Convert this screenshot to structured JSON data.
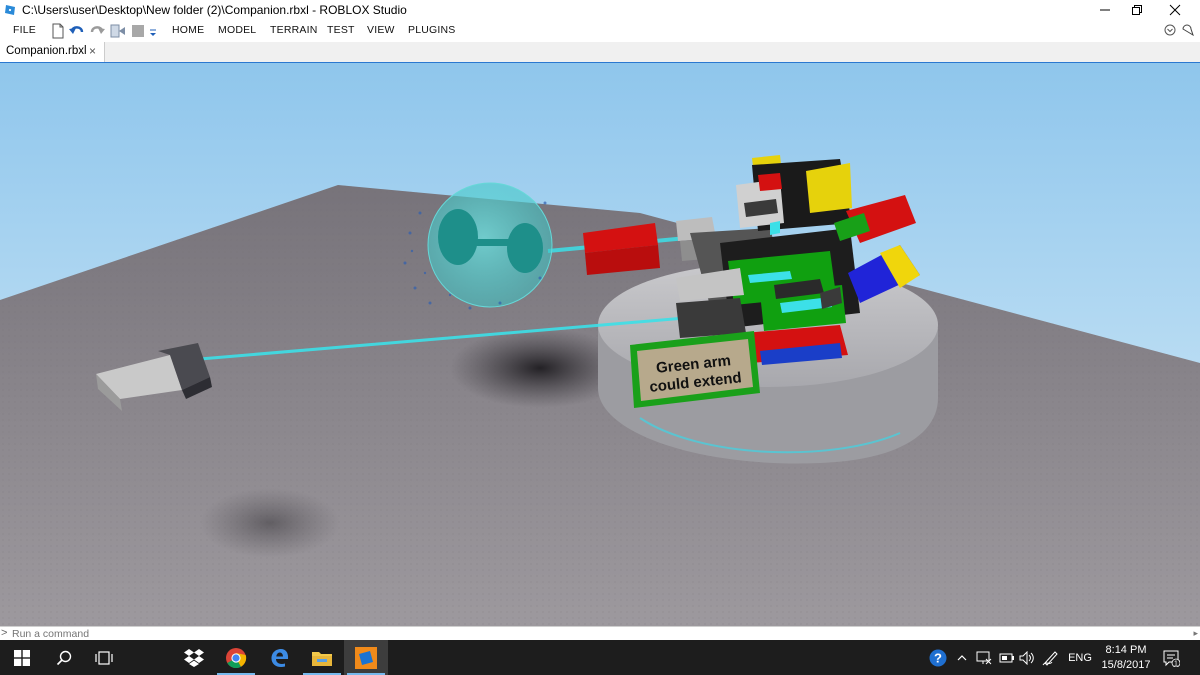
{
  "window": {
    "title": "C:\\Users\\user\\Desktop\\New folder (2)\\Companion.rbxl - ROBLOX Studio",
    "controls": {
      "minimize": "—",
      "restore": "❐",
      "close": "✕"
    }
  },
  "menubar": {
    "file": "FILE",
    "tabs": [
      "HOME",
      "MODEL",
      "TERRAIN",
      "TEST",
      "VIEW",
      "PLUGINS"
    ],
    "quick_access_icons": [
      "new-file-icon",
      "open-folder-icon",
      "undo-icon",
      "redo-icon",
      "deploy-icon",
      "stop-icon",
      "customize-dropdown-icon"
    ]
  },
  "tabstrip": {
    "active_tab": "Companion.rbxl",
    "close_glyph": "×"
  },
  "viewport": {
    "sign_line1": "Green arm",
    "sign_line2": "could extend"
  },
  "command_bar": {
    "prompt": ">",
    "placeholder": "Run a command"
  },
  "taskbar": {
    "apps": [
      "windows-start-icon",
      "search-icon",
      "task-view-icon",
      "dropbox-icon",
      "chrome-icon",
      "edge-icon",
      "file-explorer-icon",
      "roblox-studio-icon"
    ],
    "language": "ENG",
    "time": "8:14 PM",
    "date": "15/8/2017",
    "notification_count": "1"
  },
  "colors": {
    "sky_top": "#8ec8ee",
    "sky_bottom": "#dceff9",
    "baseplate": "#8e8a8f",
    "accent": "#2b78d0",
    "taskbar": "#1d1d1d"
  }
}
